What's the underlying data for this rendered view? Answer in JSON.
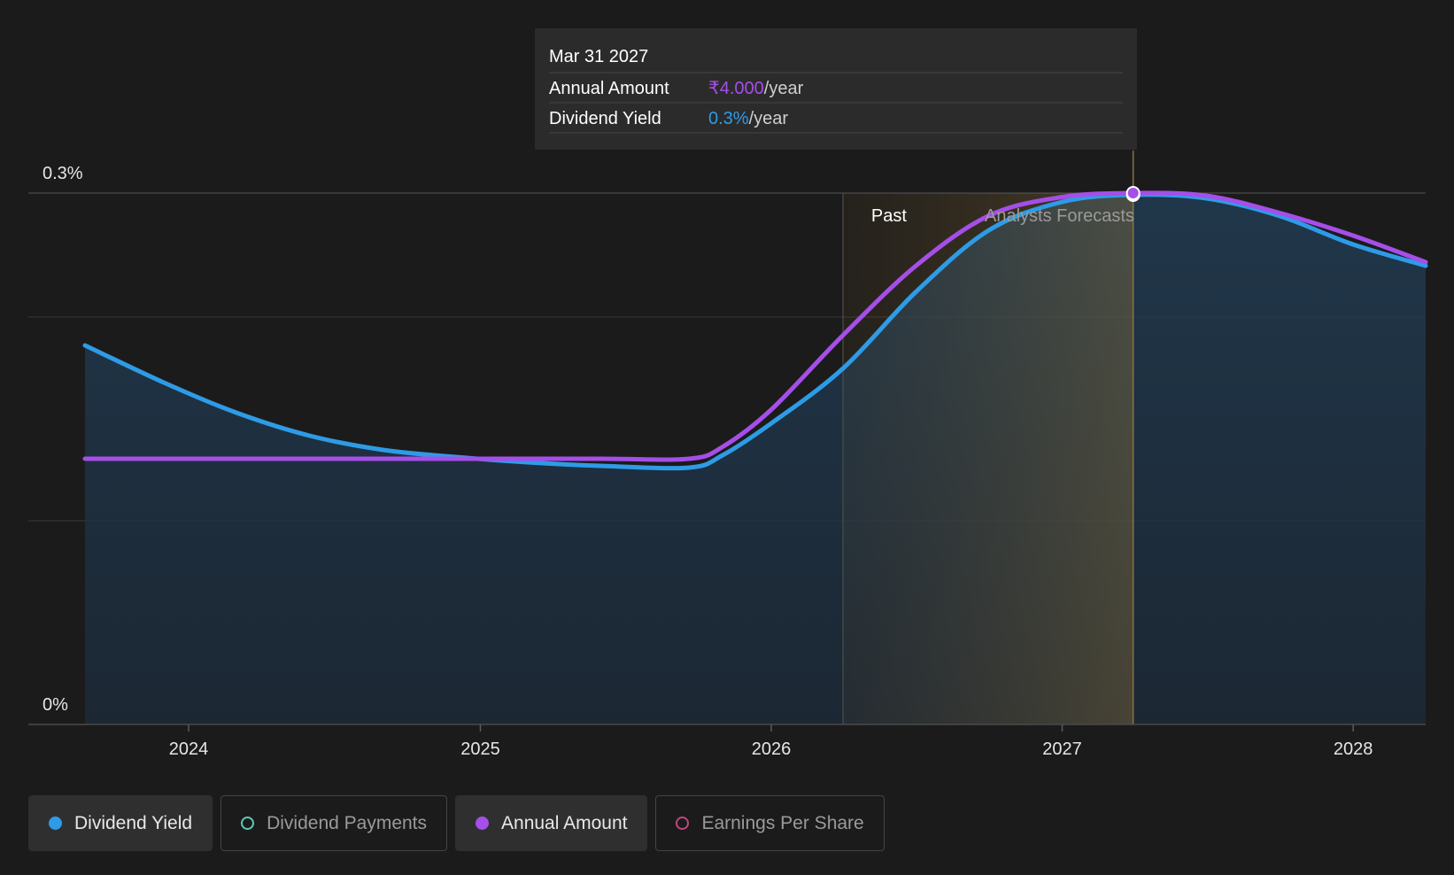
{
  "chart_data": {
    "type": "line",
    "y_axis": {
      "range": [
        0,
        0.3
      ],
      "tick_labels": [
        "0.3%",
        "0%"
      ]
    },
    "x_axis": {
      "range": [
        "2023-08-24",
        "2028-04-01"
      ],
      "tick_labels": [
        "2024",
        "2025",
        "2026",
        "2027",
        "2028"
      ]
    },
    "series": [
      {
        "name": "Dividend Yield",
        "color": "#2e9be6",
        "unit": "%",
        "points": [
          [
            "2023-08-24",
            0.214
          ],
          [
            "2023-12-01",
            0.193
          ],
          [
            "2024-03-01",
            0.176
          ],
          [
            "2024-06-01",
            0.163
          ],
          [
            "2024-09-01",
            0.155
          ],
          [
            "2024-12-01",
            0.151
          ],
          [
            "2025-03-01",
            0.148
          ],
          [
            "2025-06-01",
            0.146
          ],
          [
            "2025-09-20",
            0.145
          ],
          [
            "2025-11-01",
            0.152
          ],
          [
            "2026-01-01",
            0.17
          ],
          [
            "2026-04-01",
            0.201
          ],
          [
            "2026-07-01",
            0.244
          ],
          [
            "2026-10-01",
            0.279
          ],
          [
            "2027-01-01",
            0.295
          ],
          [
            "2027-03-31",
            0.299
          ],
          [
            "2027-07-01",
            0.297
          ],
          [
            "2027-10-01",
            0.287
          ],
          [
            "2028-01-01",
            0.271
          ],
          [
            "2028-04-01",
            0.259
          ]
        ]
      },
      {
        "name": "Annual Amount",
        "color": "#a54ee8",
        "unit": "₹",
        "points": [
          [
            "2023-08-24",
            2.0
          ],
          [
            "2024-06-01",
            2.0
          ],
          [
            "2025-01-01",
            2.0
          ],
          [
            "2025-06-01",
            2.0
          ],
          [
            "2025-09-20",
            2.0
          ],
          [
            "2025-11-01",
            2.09
          ],
          [
            "2026-01-01",
            2.37
          ],
          [
            "2026-04-01",
            2.93
          ],
          [
            "2026-07-01",
            3.45
          ],
          [
            "2026-10-01",
            3.83
          ],
          [
            "2027-01-01",
            3.97
          ],
          [
            "2027-03-31",
            4.0
          ],
          [
            "2027-07-01",
            3.98
          ],
          [
            "2027-10-01",
            3.85
          ],
          [
            "2028-01-01",
            3.68
          ],
          [
            "2028-04-01",
            3.48
          ]
        ]
      }
    ],
    "regions": {
      "past_label": "Past",
      "forecast_label": "Analysts Forecasts"
    },
    "tooltip": {
      "date": "Mar 31 2027",
      "rows": [
        {
          "label": "Annual Amount",
          "value": "₹4.000",
          "suffix": "/year",
          "color": "#a54ee8"
        },
        {
          "label": "Dividend Yield",
          "value": "0.3%",
          "suffix": "/year",
          "color": "#2e9be6"
        }
      ]
    }
  },
  "legend": [
    {
      "label": "Dividend Yield",
      "color": "#2e9be6",
      "active": true
    },
    {
      "label": "Dividend Payments",
      "color": "#5fc9b5",
      "active": false
    },
    {
      "label": "Annual Amount",
      "color": "#a54ee8",
      "active": true
    },
    {
      "label": "Earnings Per Share",
      "color": "#c2467e",
      "active": false
    }
  ]
}
